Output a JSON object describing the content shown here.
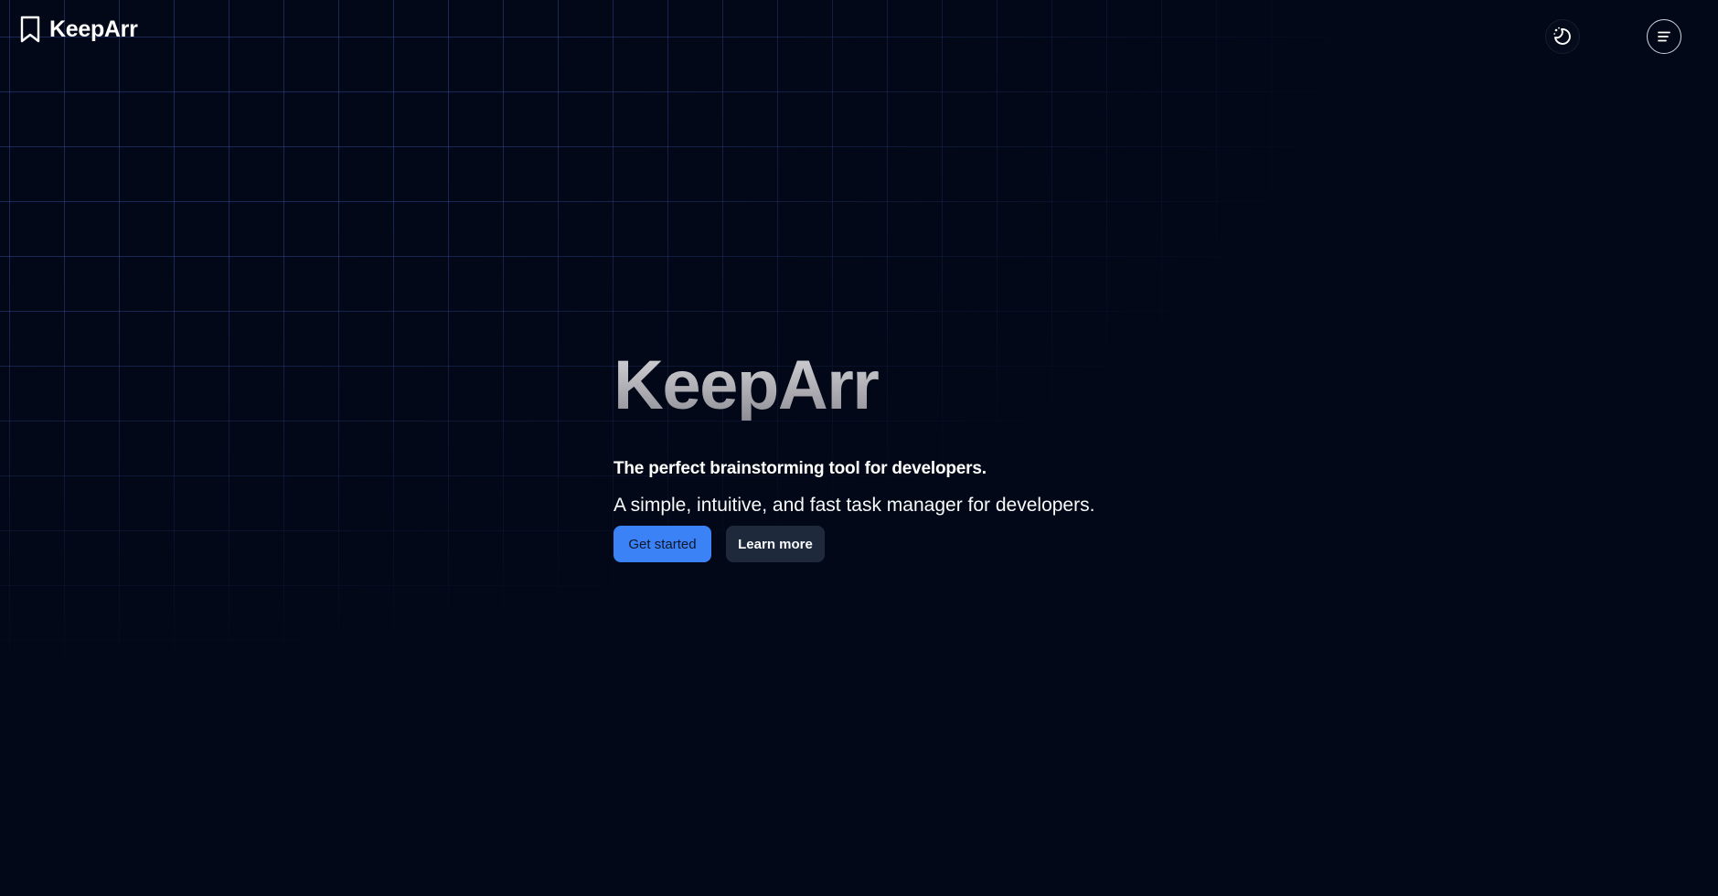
{
  "header": {
    "brand_name": "KeepArr",
    "brand_icon": "bookmark-icon",
    "theme_toggle_icon": "moon-sparkle-icon",
    "menu_icon": "menu-icon"
  },
  "hero": {
    "title": "KeepArr",
    "tagline": "The perfect brainstorming tool for developers.",
    "description": "A simple, intuitive, and fast task manager for developers.",
    "primary_button": "Get started",
    "secondary_button": "Learn more"
  },
  "colors": {
    "background": "#020817",
    "grid_line": "#3b4fa0",
    "accent": "#3b82f6",
    "secondary_button": "#1e293b"
  }
}
